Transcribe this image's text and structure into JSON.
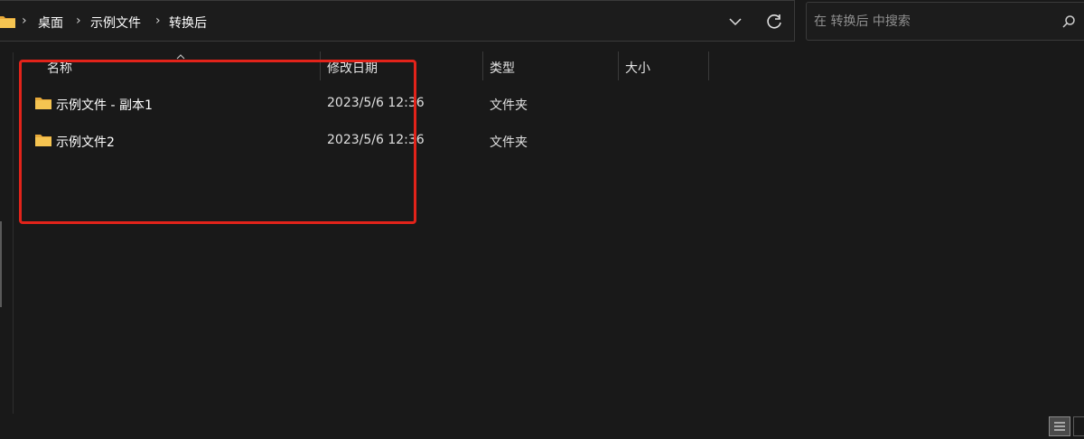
{
  "address_bar": {
    "breadcrumbs": [
      "桌面",
      "示例文件",
      "转换后"
    ]
  },
  "search": {
    "placeholder": "在 转换后 中搜索"
  },
  "columns": {
    "name": "名称",
    "modified": "修改日期",
    "type": "类型",
    "size": "大小"
  },
  "files": [
    {
      "name": "示例文件 - 副本1",
      "modified": "2023/5/6 12:36",
      "type": "文件夹"
    },
    {
      "name": "示例文件2",
      "modified": "2023/5/6 12:36",
      "type": "文件夹"
    }
  ],
  "colors": {
    "background": "#191919",
    "folder_yellow": "#f5c451",
    "highlight_red": "#e2231a"
  }
}
